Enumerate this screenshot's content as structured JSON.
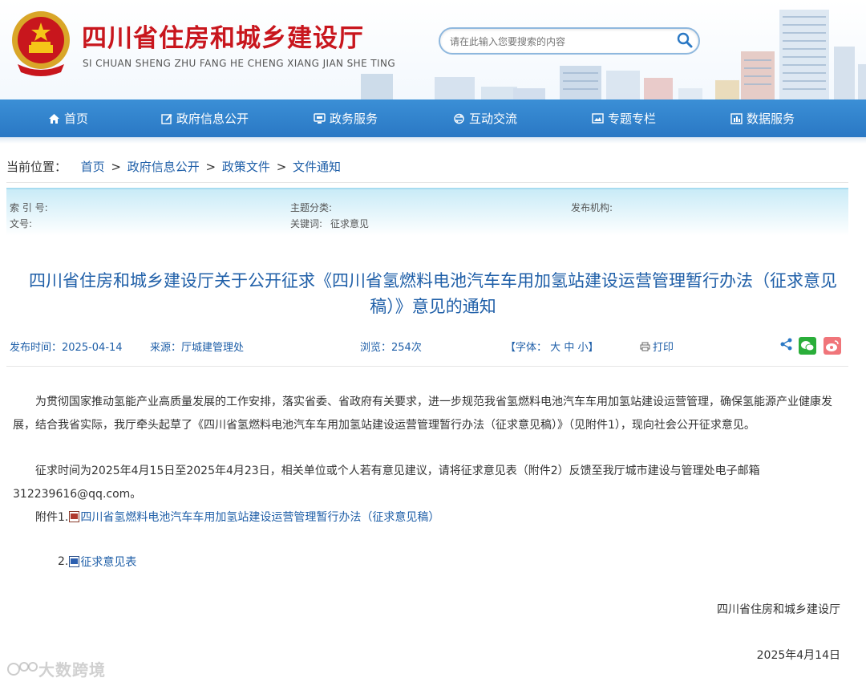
{
  "header": {
    "title": "四川省住房和城乡建设厅",
    "pinyin": "SI CHUAN SHENG ZHU FANG HE CHENG XIANG JIAN SHE TING",
    "search_placeholder": "请在此输入您要搜索的内容"
  },
  "nav": {
    "items": [
      {
        "label": "首页",
        "icon": "home-icon"
      },
      {
        "label": "政府信息公开",
        "icon": "edit-icon"
      },
      {
        "label": "政务服务",
        "icon": "service-icon"
      },
      {
        "label": "互动交流",
        "icon": "exchange-icon"
      },
      {
        "label": "专题专栏",
        "icon": "image-icon"
      },
      {
        "label": "数据服务",
        "icon": "data-icon"
      }
    ]
  },
  "breadcrumb": {
    "prefix": "当前位置：",
    "items": [
      "首页",
      "政府信息公开",
      "政策文件",
      "文件通知"
    ],
    "separator": ">"
  },
  "meta": {
    "index_label": "索 引 号:",
    "category_label": "主题分类:",
    "issuer_label": "发布机构:",
    "doc_no_label": "文号:",
    "keywords_label": "关键词:",
    "keywords_value": "征求意见"
  },
  "article": {
    "title": "四川省住房和城乡建设厅关于公开征求《四川省氢燃料电池汽车车用加氢站建设运营管理暂行办法（征求意见稿）》意见的通知",
    "publish_label": "发布时间：",
    "publish_date": "2025-04-14",
    "source_label": "来源：",
    "source_value": "厅城建管理处",
    "views_label": "浏览：",
    "views_value": "254次",
    "font_label": "【字体：",
    "font_large": "大",
    "font_medium": "中",
    "font_small": "小】",
    "print_label": "打印",
    "paragraph1": "为贯彻国家推动氢能产业高质量发展的工作安排，落实省委、省政府有关要求，进一步规范我省氢燃料电池汽车车用加氢站建设运营管理，确保氢能源产业健康发展，结合我省实际，我厅牵头起草了《四川省氢燃料电池汽车车用加氢站建设运营管理暂行办法（征求意见稿）》（见附件1），现向社会公开征求意见。",
    "paragraph2": "征求时间为2025年4月15日至2025年4月23日，相关单位或个人若有意见建议，请将征求意见表（附件2）反馈至我厅城市建设与管理处电子邮箱312239616@qq.com。",
    "attach1_prefix": "附件1.",
    "attach1_link": "四川省氢燃料电池汽车车用加氢站建设运营管理暂行办法（征求意见稿）",
    "attach2_prefix": "2.",
    "attach2_link": "征求意见表",
    "signature": "四川省住房和城乡建设厅",
    "sign_date": "2025年4月14日"
  },
  "watermark": "大数跨境",
  "colors": {
    "brand_red": "#c8161d",
    "nav_blue": "#2a78c4",
    "link_blue": "#1f5fa8",
    "meta_bg": "#c9ebf7"
  }
}
